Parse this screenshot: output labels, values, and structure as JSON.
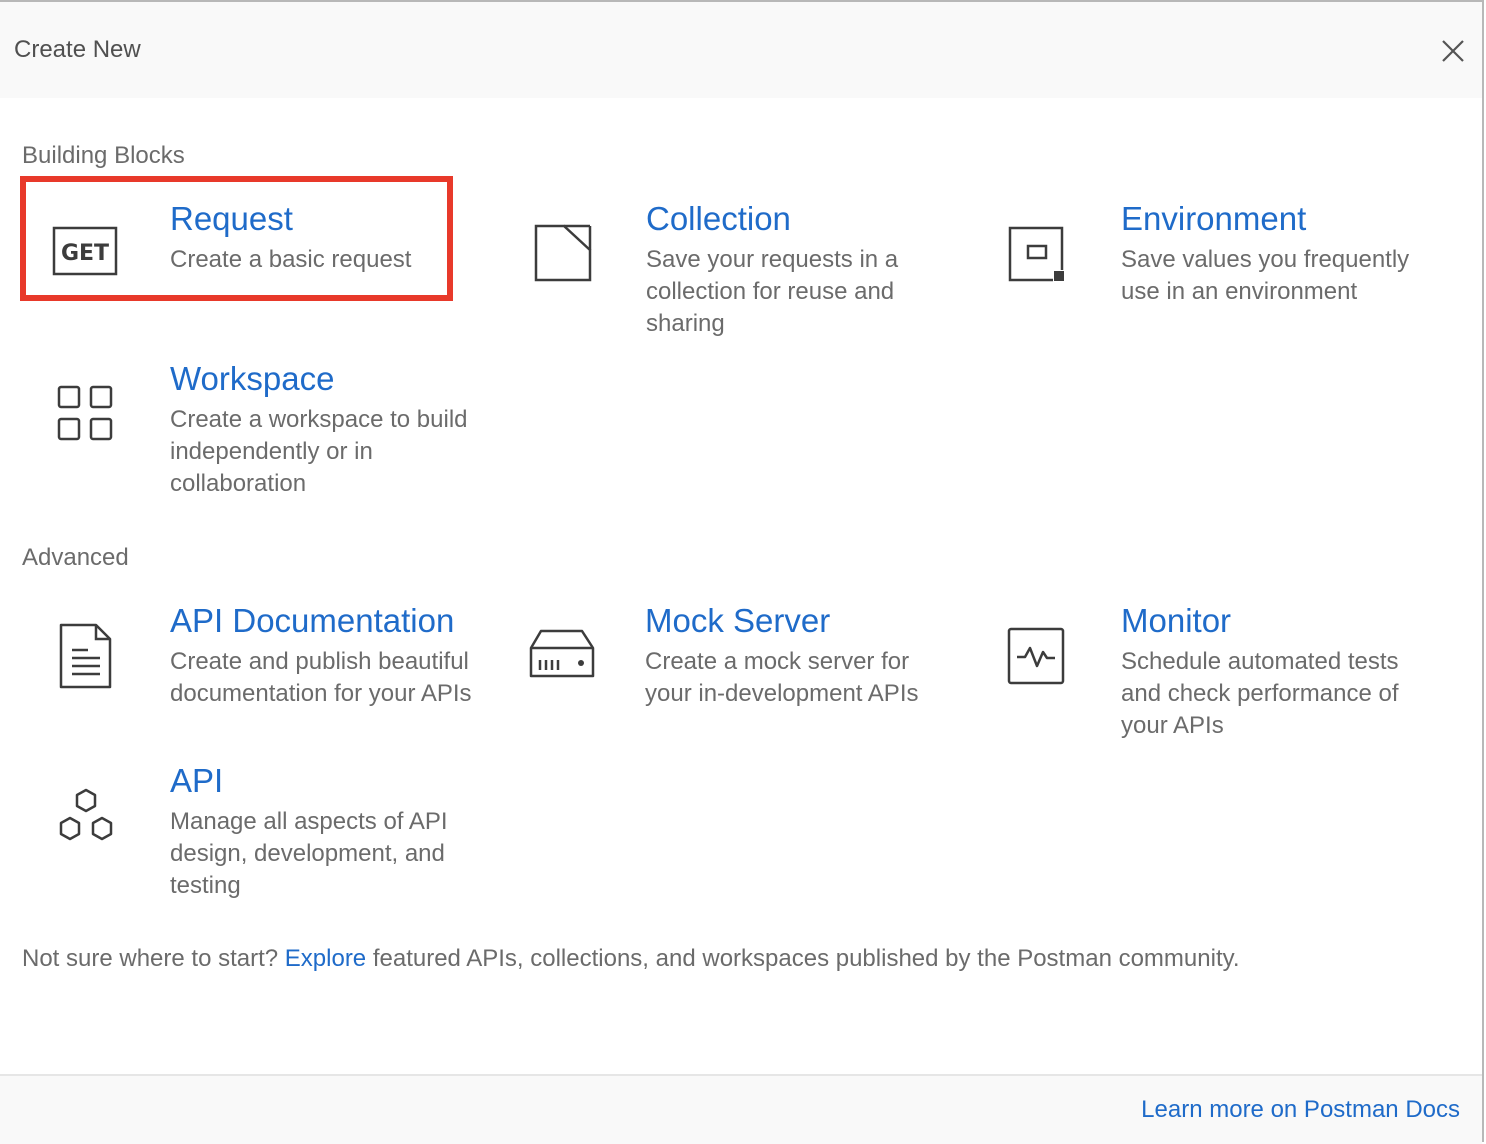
{
  "header": {
    "title": "Create New",
    "close_icon": "close-icon"
  },
  "sections": {
    "building_blocks": "Building Blocks",
    "advanced": "Advanced"
  },
  "cards": {
    "request": {
      "title": "Request",
      "desc": "Create a basic request",
      "icon": "get-request-icon",
      "highlighted": true,
      "highlight_color": "#e8392a"
    },
    "collection": {
      "title": "Collection",
      "desc": "Save your requests in a collection for reuse and sharing",
      "icon": "collection-folder-icon"
    },
    "environment": {
      "title": "Environment",
      "desc": "Save values you frequently use in an environment",
      "icon": "environment-icon"
    },
    "workspace": {
      "title": "Workspace",
      "desc": "Create a workspace to build independently or in collaboration",
      "icon": "workspace-grid-icon"
    },
    "api_documentation": {
      "title": "API Documentation",
      "desc": "Create and publish beautiful documentation for your APIs",
      "icon": "document-icon"
    },
    "mock_server": {
      "title": "Mock Server",
      "desc": "Create a mock server for your in-development APIs",
      "icon": "server-icon"
    },
    "monitor": {
      "title": "Monitor",
      "desc": "Schedule automated tests and check performance of your APIs",
      "icon": "monitor-pulse-icon"
    },
    "api": {
      "title": "API",
      "desc": "Manage all aspects of API design, development, and testing",
      "icon": "hexagons-icon"
    }
  },
  "footer": {
    "prefix": "Not sure where to start? ",
    "link": "Explore",
    "suffix": " featured APIs, collections, and workspaces published by the Postman community.",
    "docs_link": "Learn more on Postman Docs"
  },
  "colors": {
    "link_blue": "#1f6bc9",
    "text_gray": "#6b6b6b",
    "icon_dark": "#3c3c3c",
    "highlight_red": "#e8392a"
  }
}
